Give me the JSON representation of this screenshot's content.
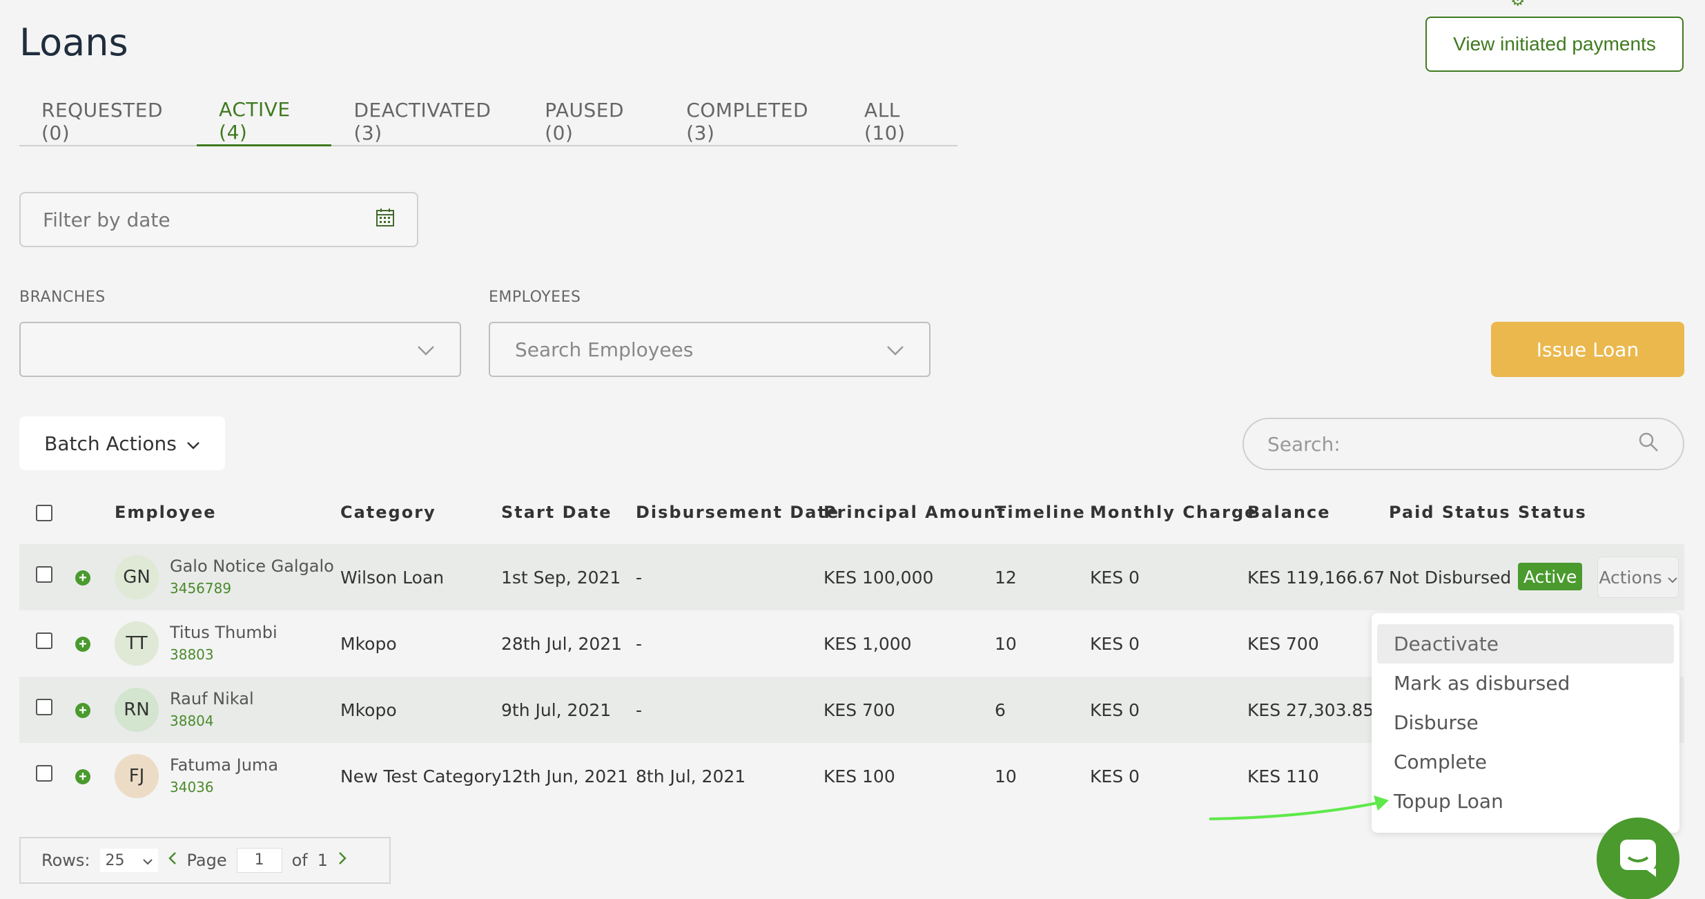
{
  "page": {
    "title": "Loans"
  },
  "header": {
    "view_payments_label": "View initiated payments",
    "corner_text": "Settings"
  },
  "tabs": [
    {
      "label": "REQUESTED (0)"
    },
    {
      "label": "ACTIVE (4)"
    },
    {
      "label": "DEACTIVATED (3)"
    },
    {
      "label": "PAUSED (0)"
    },
    {
      "label": "COMPLETED (3)"
    },
    {
      "label": "ALL (10)"
    }
  ],
  "filter": {
    "placeholder": "Filter by date",
    "icon": "calendar-icon"
  },
  "branches": {
    "label": "BRANCHES",
    "value": ""
  },
  "employees": {
    "label": "EMPLOYEES",
    "placeholder": "Search Employees"
  },
  "issue_loan_label": "Issue Loan",
  "batch_actions_label": "Batch Actions",
  "search": {
    "placeholder": "Search:",
    "icon": "search-icon"
  },
  "table": {
    "headers": [
      "Employee",
      "Category",
      "Start Date",
      "Disbursement Date",
      "Principal Amount",
      "Timeline",
      "Monthly Charge",
      "Balance",
      "Paid Status",
      "Status"
    ],
    "rows": [
      {
        "initials": "GN",
        "name": "Galo Notice Galgalo",
        "id": "3456789",
        "category": "Wilson Loan",
        "start": "1st Sep, 2021",
        "disb": "-",
        "principal": "KES 100,000",
        "timeline": "12",
        "monthly": "KES 0",
        "balance": "KES 119,166.67",
        "paid": "Not Disbursed",
        "status": "Active",
        "actions": "Actions"
      },
      {
        "initials": "TT",
        "name": "Titus Thumbi",
        "id": "38803",
        "category": "Mkopo",
        "start": "28th Jul, 2021",
        "disb": "-",
        "principal": "KES 1,000",
        "timeline": "10",
        "monthly": "KES 0",
        "balance": "KES 700"
      },
      {
        "initials": "RN",
        "name": "Rauf Nikal",
        "id": "38804",
        "category": "Mkopo",
        "start": "9th Jul, 2021",
        "disb": "-",
        "principal": "KES 700",
        "timeline": "6",
        "monthly": "KES 0",
        "balance": "KES 27,303.85"
      },
      {
        "initials": "FJ",
        "name": "Fatuma Juma",
        "id": "34036",
        "category": "New Test Category",
        "start": "12th Jun, 2021",
        "disb": "8th Jul, 2021",
        "principal": "KES 100",
        "timeline": "10",
        "monthly": "KES 0",
        "balance": "KES 110"
      }
    ]
  },
  "actions_menu": [
    "Deactivate",
    "Mark as disbursed",
    "Disburse",
    "Complete",
    "Topup Loan"
  ],
  "pagination": {
    "rows_label": "Rows:",
    "rows_value": "25",
    "page_label": "Page",
    "page_value": "1",
    "of_label": "of",
    "total_pages": "1"
  },
  "colors": {
    "brand_green": "#3f7a1f",
    "issue_yellow": "#eab84d",
    "active_badge": "#4a9a2e",
    "annotation_arrow": "#5ee84a"
  }
}
